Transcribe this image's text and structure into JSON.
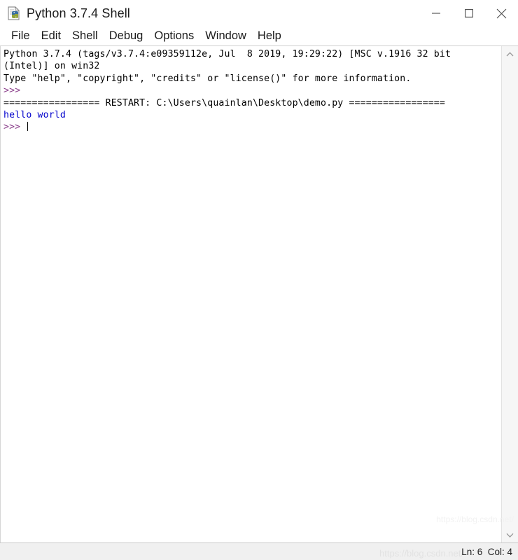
{
  "window": {
    "title": "Python 3.7.4 Shell",
    "icon": "idle-python-file-icon",
    "controls": {
      "minimize": "minimize-button",
      "maximize": "maximize-button",
      "close": "close-button"
    }
  },
  "menubar": {
    "items": [
      {
        "label": "File"
      },
      {
        "label": "Edit"
      },
      {
        "label": "Shell"
      },
      {
        "label": "Debug"
      },
      {
        "label": "Options"
      },
      {
        "label": "Window"
      },
      {
        "label": "Help"
      }
    ]
  },
  "console": {
    "lines": [
      {
        "segments": [
          {
            "text": "Python 3.7.4 (tags/v3.7.4:e09359112e, Jul  8 2019, 19:29:22) [MSC v.1916 32 bit",
            "style": "plain"
          }
        ]
      },
      {
        "segments": [
          {
            "text": "(Intel)] on win32",
            "style": "plain"
          }
        ]
      },
      {
        "segments": [
          {
            "text": "Type \"help\", \"copyright\", \"credits\" or \"license()\" for more information.",
            "style": "plain"
          }
        ]
      },
      {
        "segments": [
          {
            "text": ">>>",
            "style": "prompt"
          }
        ]
      },
      {
        "segments": [
          {
            "text": "================= RESTART: C:\\Users\\quainlan\\Desktop\\demo.py =================",
            "style": "plain"
          }
        ]
      },
      {
        "segments": [
          {
            "text": "hello world",
            "style": "output"
          }
        ]
      },
      {
        "segments": [
          {
            "text": ">>> ",
            "style": "prompt"
          },
          {
            "text": "",
            "style": "caret"
          }
        ]
      }
    ]
  },
  "scrollbar": {
    "up_arrow": "scroll-up-arrow",
    "down_arrow": "scroll-down-arrow"
  },
  "statusbar": {
    "position": "Ln: 6  Col: 4",
    "watermark": "https://blog.csdn.net/"
  },
  "colors": {
    "prompt": "#8b3f8b",
    "output": "#0000cc",
    "text": "#000000",
    "background": "#ffffff",
    "statusbar_bg": "#f0f0f0"
  }
}
